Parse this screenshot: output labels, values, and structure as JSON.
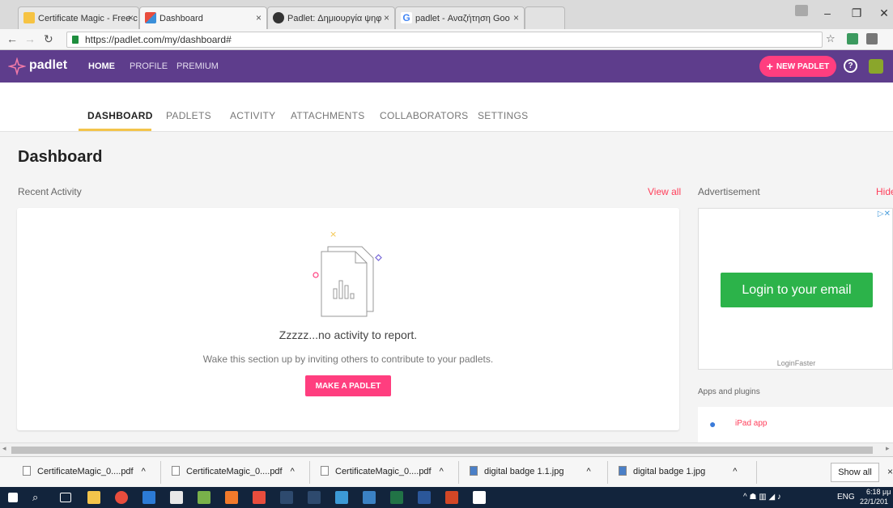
{
  "browser": {
    "tabs": [
      {
        "title": "Certificate Magic - Free c",
        "close": "×"
      },
      {
        "title": "Dashboard",
        "close": "×"
      },
      {
        "title": "Padlet: Δημιουργία ψηφ",
        "close": "×"
      },
      {
        "title": "padlet - Αναζήτηση Goo",
        "close": "×"
      }
    ],
    "url": "https://padlet.com/my/dashboard#",
    "window_controls": {
      "minimize": "–",
      "maximize": "❐",
      "close": "✕"
    }
  },
  "header": {
    "logo": "padlet",
    "nav": [
      "HOME",
      "PROFILE",
      "PREMIUM"
    ],
    "new_padlet": "NEW PADLET",
    "new_padlet_plus": "+",
    "help_icon": "?"
  },
  "subtabs": [
    "DASHBOARD",
    "PADLETS",
    "ACTIVITY",
    "ATTACHMENTS",
    "COLLABORATORS",
    "SETTINGS"
  ],
  "main": {
    "title": "Dashboard",
    "recent_activity": "Recent Activity",
    "view_all": "View all",
    "empty_title": "Zzzzz...no activity to report.",
    "empty_sub": "Wake this section up by inviting others to contribute to your padlets.",
    "make_padlet": "MAKE A PADLET"
  },
  "sidebar": {
    "advertisement": "Advertisement",
    "hide": "Hide",
    "ad_button": "Login to your email",
    "ad_source": "LoginFaster",
    "apps_label": "Apps and plugins",
    "ipad_app": "iPad app"
  },
  "downloads": {
    "items": [
      "CertificateMagic_0....pdf",
      "CertificateMagic_0....pdf",
      "CertificateMagic_0....pdf",
      "digital badge 1.1.jpg",
      "digital badge 1.jpg"
    ],
    "show_all": "Show all"
  },
  "taskbar": {
    "lang": "ENG",
    "time": "6:18 μμ",
    "date": "22/1/201"
  },
  "colors": {
    "brand_purple": "#5e3d8c",
    "accent_pink": "#ff3e7f",
    "tab_underline": "#f3c44b",
    "ad_green": "#2cb34a"
  }
}
